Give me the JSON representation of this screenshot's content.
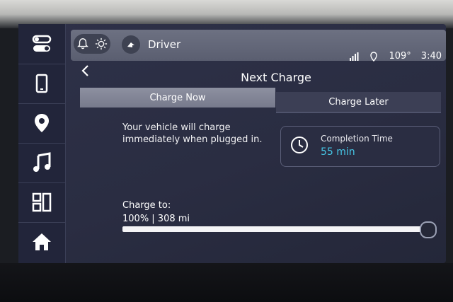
{
  "status": {
    "profile": "Driver",
    "temperature": "109°",
    "time": "3:40"
  },
  "header": {
    "title": "Next Charge"
  },
  "tabs": [
    {
      "label": "Charge Now",
      "selected": true
    },
    {
      "label": "Charge Later",
      "selected": false
    }
  ],
  "description": "Your vehicle will charge immediately when plugged in.",
  "completion": {
    "label": "Completion Time",
    "value": "55 min"
  },
  "charge_to": {
    "label": "Charge to:",
    "value": "100% | 308 mi",
    "level": 1.0
  },
  "icons": {
    "rail": [
      "apps-toggle-icon",
      "phone-icon",
      "location-pin-icon",
      "music-note-icon",
      "layout-grid-icon",
      "home-icon"
    ],
    "status": [
      "bell-icon",
      "sun-settings-icon",
      "user-profile-icon",
      "signal-icon",
      "location-pin-icon"
    ]
  },
  "colors": {
    "accent": "#46c6e6",
    "selected_tab": "#8d90a0",
    "screen_bg": "#2a2d42"
  }
}
